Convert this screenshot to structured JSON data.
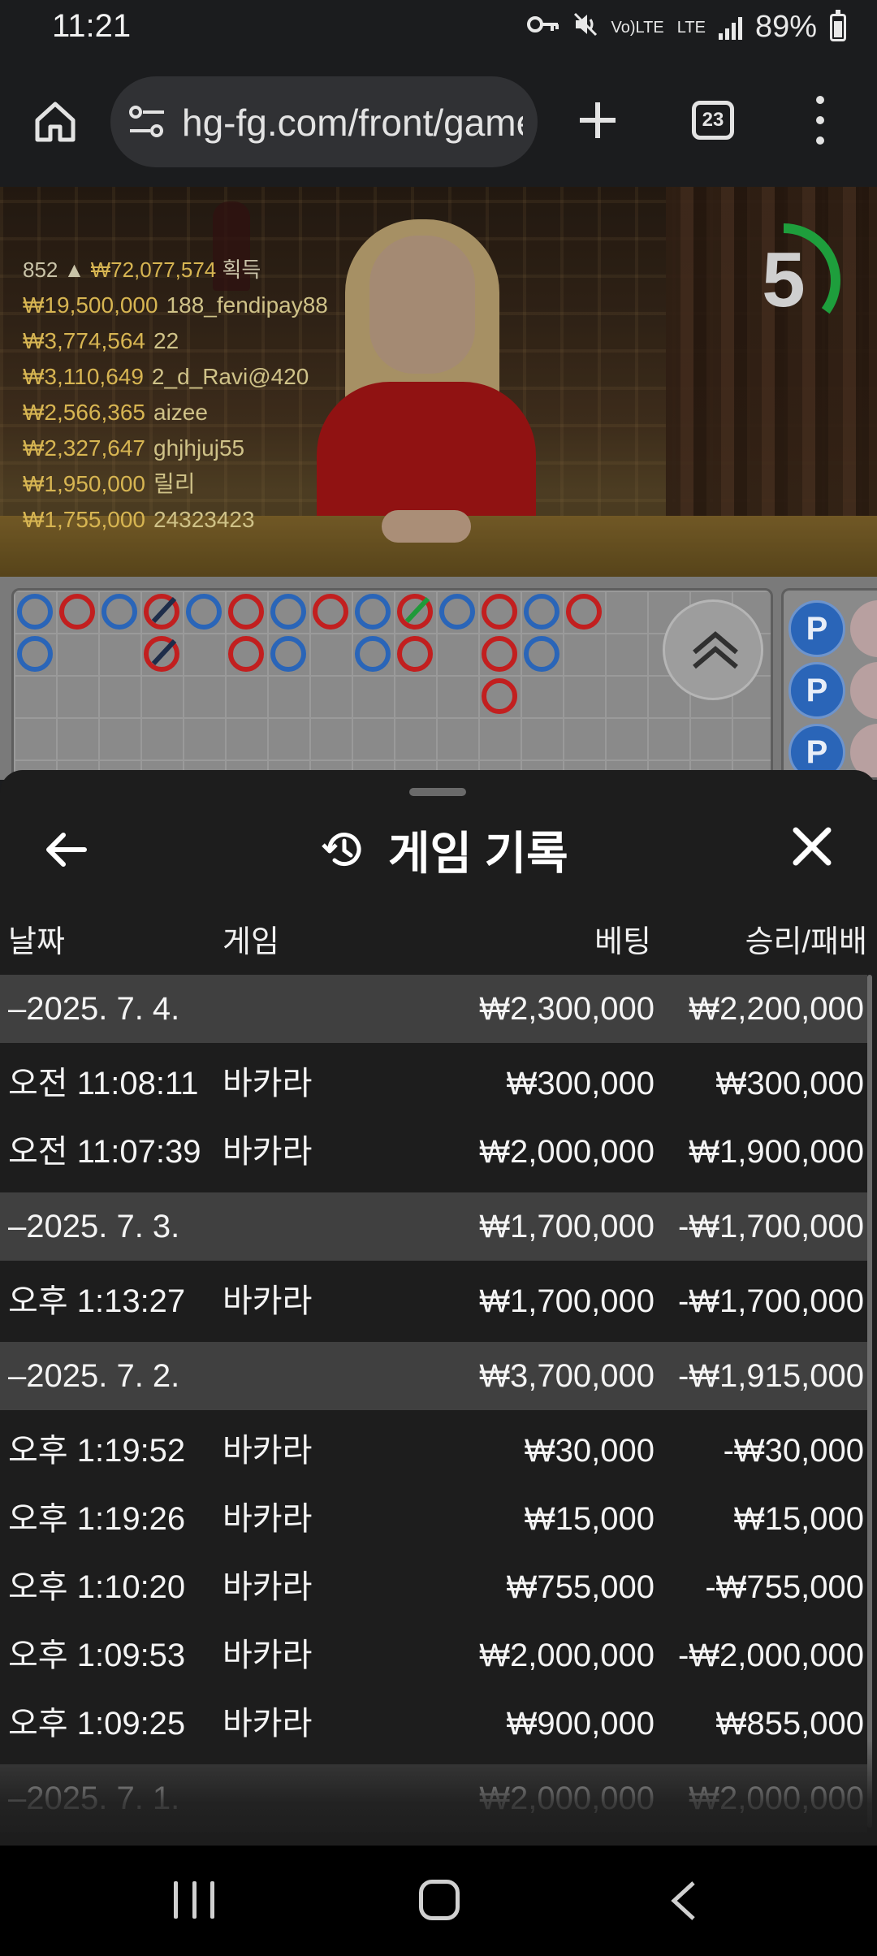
{
  "status_bar": {
    "time": "11:21",
    "volte": "Vo)LTE",
    "lte": "LTE",
    "battery": "89%"
  },
  "browser": {
    "url": "hg-fg.com/front/game",
    "tab_count": "23"
  },
  "live_game": {
    "winners_header": {
      "count": "852",
      "total": "₩72,077,574",
      "suffix": "획득"
    },
    "winners": [
      {
        "amount": "₩19,500,000",
        "name": "188_fendipay88"
      },
      {
        "amount": "₩3,774,564",
        "name": "22"
      },
      {
        "amount": "₩3,110,649",
        "name": "2_d_Ravi@420"
      },
      {
        "amount": "₩2,566,365",
        "name": "aizee"
      },
      {
        "amount": "₩2,327,647",
        "name": "ghjhjuj55"
      },
      {
        "amount": "₩1,950,000",
        "name": "릴리"
      },
      {
        "amount": "₩1,755,000",
        "name": "24323423"
      }
    ],
    "countdown": "5",
    "countdown_fraction": 0.35,
    "bead_label": "P",
    "colors": {
      "player": "#2a65b8",
      "banker": "#c21f1f",
      "tie": "#1f9a3a"
    }
  },
  "history_sheet": {
    "title": "게임 기록",
    "columns": {
      "date": "날짜",
      "game": "게임",
      "bet": "베팅",
      "win_loss": "승리/패배"
    },
    "days": [
      {
        "date": "–2025. 7. 4.",
        "bet": "₩2,300,000",
        "win_loss": "₩2,200,000",
        "games": [
          {
            "time": "오전 11:08:11",
            "game": "바카라",
            "bet": "₩300,000",
            "win_loss": "₩300,000"
          },
          {
            "time": "오전 11:07:39",
            "game": "바카라",
            "bet": "₩2,000,000",
            "win_loss": "₩1,900,000"
          }
        ]
      },
      {
        "date": "–2025. 7. 3.",
        "bet": "₩1,700,000",
        "win_loss": "-₩1,700,000",
        "games": [
          {
            "time": "오후 1:13:27",
            "game": "바카라",
            "bet": "₩1,700,000",
            "win_loss": "-₩1,700,000"
          }
        ]
      },
      {
        "date": "–2025. 7. 2.",
        "bet": "₩3,700,000",
        "win_loss": "-₩1,915,000",
        "games": [
          {
            "time": "오후 1:19:52",
            "game": "바카라",
            "bet": "₩30,000",
            "win_loss": "-₩30,000"
          },
          {
            "time": "오후 1:19:26",
            "game": "바카라",
            "bet": "₩15,000",
            "win_loss": "₩15,000"
          },
          {
            "time": "오후 1:10:20",
            "game": "바카라",
            "bet": "₩755,000",
            "win_loss": "-₩755,000"
          },
          {
            "time": "오후 1:09:53",
            "game": "바카라",
            "bet": "₩2,000,000",
            "win_loss": "-₩2,000,000"
          },
          {
            "time": "오후 1:09:25",
            "game": "바카라",
            "bet": "₩900,000",
            "win_loss": "₩855,000"
          }
        ]
      },
      {
        "date": "–2025. 7. 1.",
        "bet": "₩2,000,000",
        "win_loss": "₩2,000,000",
        "games": []
      }
    ]
  }
}
